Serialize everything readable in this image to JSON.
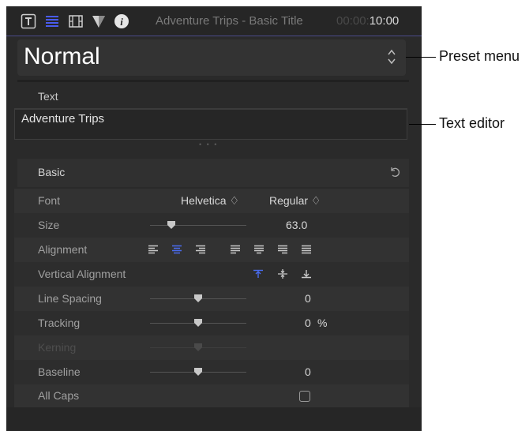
{
  "toolbar": {
    "title": "Adventure Trips - Basic Title",
    "timecode_dim": "00:00:",
    "timecode_bright": "10:00",
    "icons": [
      "text-inspector-icon",
      "paragraph-icon",
      "film-icon",
      "filter-icon",
      "info-icon"
    ],
    "accent_color": "#4a5cf0"
  },
  "preset": {
    "label": "Normal"
  },
  "text_section": {
    "label": "Text",
    "value": "Adventure Trips",
    "dots": "• • •"
  },
  "basic": {
    "label": "Basic",
    "font": {
      "label": "Font",
      "family": "Helvetica ♢",
      "style": "Regular ♢"
    },
    "size": {
      "label": "Size",
      "value": "63.0"
    },
    "alignment": {
      "label": "Alignment",
      "selected": "center"
    },
    "vertical_alignment": {
      "label": "Vertical Alignment",
      "selected": "top"
    },
    "line_spacing": {
      "label": "Line Spacing",
      "value": "0"
    },
    "tracking": {
      "label": "Tracking",
      "value": "0",
      "unit": "%"
    },
    "kerning": {
      "label": "Kerning"
    },
    "baseline": {
      "label": "Baseline",
      "value": "0"
    },
    "all_caps": {
      "label": "All Caps",
      "checked": false
    }
  },
  "callouts": {
    "preset_menu": "Preset menu",
    "text_editor": "Text editor"
  }
}
